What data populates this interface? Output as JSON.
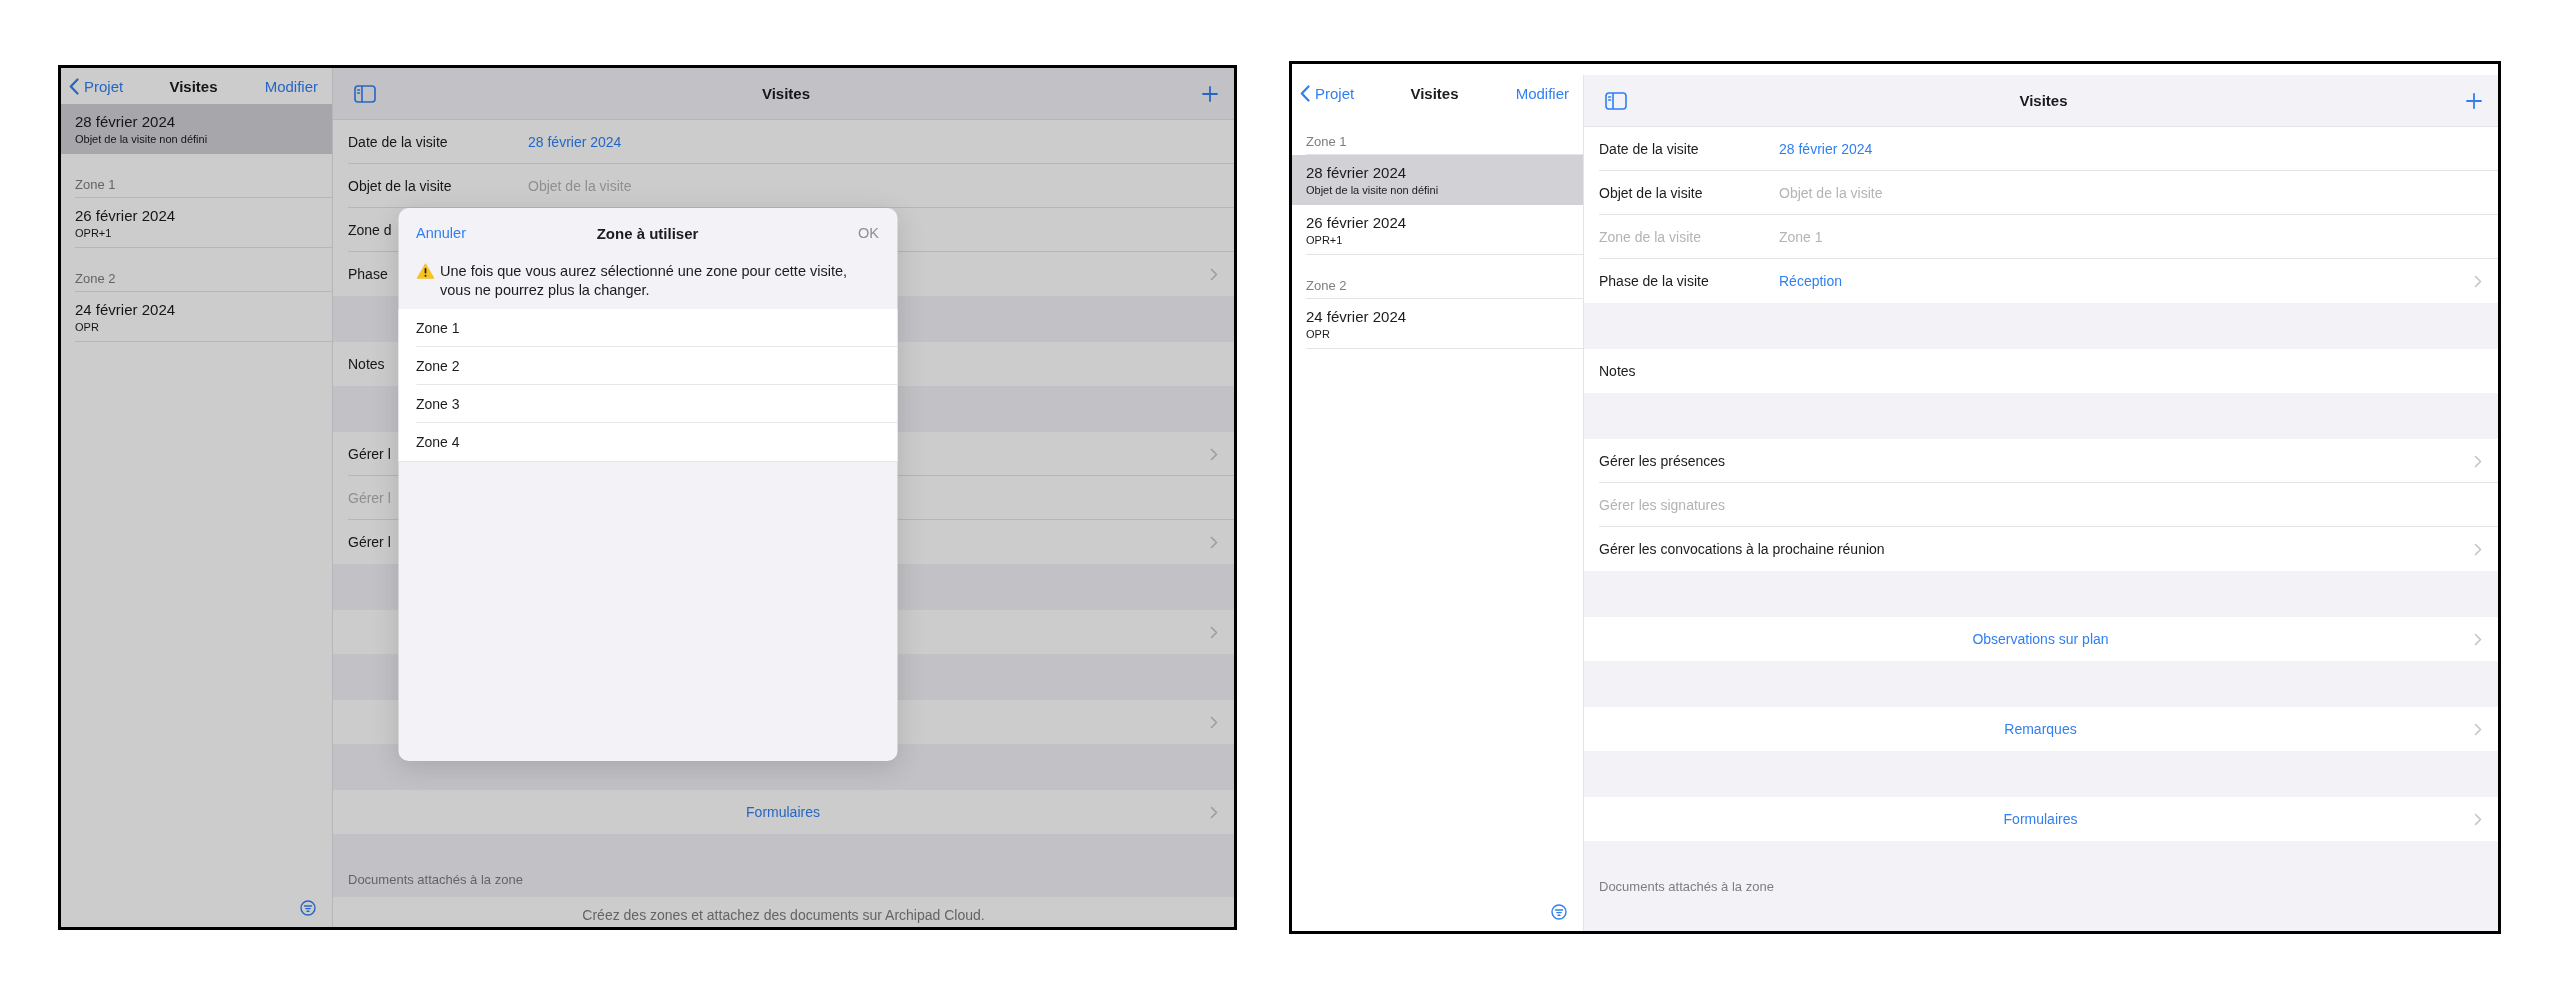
{
  "screens": [
    {
      "dimmed": true,
      "sidebar": {
        "back": "Projet",
        "title": "Visites",
        "edit": "Modifier",
        "sections": [
          {
            "items": [
              {
                "date": "28 février 2024",
                "subtitle": "Objet de la visite non défini",
                "selected": true
              }
            ]
          },
          {
            "title": "Zone 1",
            "items": [
              {
                "date": "26 février 2024",
                "subtitle": "OPR+1",
                "selected": false
              }
            ]
          },
          {
            "title": "Zone 2",
            "items": [
              {
                "date": "24 février 2024",
                "subtitle": "OPR",
                "selected": false
              }
            ]
          }
        ]
      },
      "detail": {
        "title": "Visites",
        "groups": [
          {
            "rows": [
              {
                "kind": "field",
                "label": "Date de la visite",
                "value": "28 février 2024",
                "disabled": false,
                "chevron": false
              },
              {
                "kind": "field",
                "label": "Objet de la visite",
                "placeholder": "Objet de la visite",
                "disabled": false,
                "chevron": false
              },
              {
                "kind": "field",
                "label": "Zone d",
                "disabled": false,
                "chevron": false
              },
              {
                "kind": "field",
                "label": "Phase",
                "disabled": false,
                "chevron": true
              }
            ]
          },
          {
            "rows": [
              {
                "kind": "field",
                "label": "Notes",
                "disabled": false,
                "chevron": false
              }
            ]
          },
          {
            "rows": [
              {
                "kind": "field",
                "label": "Gérer l",
                "disabled": false,
                "chevron": true
              },
              {
                "kind": "field",
                "label": "Gérer l",
                "disabled": true,
                "chevron": false
              },
              {
                "kind": "field",
                "label": "Gérer l",
                "disabled": false,
                "chevron": true
              }
            ]
          },
          {
            "rows": [
              {
                "kind": "action",
                "disabled": false,
                "chevron": true
              }
            ]
          },
          {
            "rows": [
              {
                "kind": "action",
                "disabled": false,
                "chevron": true
              }
            ]
          },
          {
            "rows": [
              {
                "kind": "action",
                "label": "Formulaires",
                "disabled": false,
                "chevron": true
              }
            ]
          }
        ],
        "footer": {
          "caption": "Documents attachés à la zone",
          "info": "Créez des zones et attachez des documents sur Archipad Cloud."
        }
      },
      "modal": {
        "cancel": "Annuler",
        "title": "Zone à utiliser",
        "confirm": {
          "label": "OK",
          "disabled": true
        },
        "warning": "Une fois que vous aurez sélectionné une zone pour cette visite, vous ne pourrez plus la changer.",
        "options": [
          {
            "label": "Zone 1",
            "selected": false
          },
          {
            "label": "Zone 2",
            "selected": false
          },
          {
            "label": "Zone 3",
            "selected": false
          },
          {
            "label": "Zone 4",
            "selected": false
          }
        ]
      }
    },
    {
      "dimmed": false,
      "sidebar": {
        "back": "Projet",
        "title": "Visites",
        "edit": "Modifier",
        "sections": [
          {
            "title": "Zone 1",
            "items": [
              {
                "date": "28 février 2024",
                "subtitle": "Objet de la visite non défini",
                "selected": true
              },
              {
                "date": "26 février 2024",
                "subtitle": "OPR+1",
                "selected": false
              }
            ]
          },
          {
            "title": "Zone 2",
            "items": [
              {
                "date": "24 février 2024",
                "subtitle": "OPR",
                "selected": false
              }
            ]
          }
        ]
      },
      "detail": {
        "title": "Visites",
        "groups": [
          {
            "rows": [
              {
                "kind": "field",
                "label": "Date de la visite",
                "value": "28 février 2024",
                "disabled": false,
                "chevron": false
              },
              {
                "kind": "field",
                "label": "Objet de la visite",
                "placeholder": "Objet de la visite",
                "disabled": false,
                "chevron": false
              },
              {
                "kind": "field",
                "label": "Zone de la visite",
                "value": "Zone 1",
                "disabled": true,
                "chevron": false
              },
              {
                "kind": "field",
                "label": "Phase de la visite",
                "value": "Réception",
                "disabled": false,
                "chevron": true
              }
            ]
          },
          {
            "rows": [
              {
                "kind": "field",
                "label": "Notes",
                "disabled": false,
                "chevron": false
              }
            ]
          },
          {
            "rows": [
              {
                "kind": "field",
                "label": "Gérer les présences",
                "disabled": false,
                "chevron": true
              },
              {
                "kind": "field",
                "label": "Gérer les signatures",
                "disabled": true,
                "chevron": false
              },
              {
                "kind": "field",
                "label": "Gérer les convocations à la prochaine réunion",
                "disabled": false,
                "chevron": true
              }
            ]
          },
          {
            "rows": [
              {
                "kind": "action",
                "label": "Observations sur plan",
                "disabled": false,
                "chevron": true
              }
            ]
          },
          {
            "rows": [
              {
                "kind": "action",
                "label": "Remarques",
                "disabled": false,
                "chevron": true
              }
            ]
          },
          {
            "rows": [
              {
                "kind": "action",
                "label": "Formulaires",
                "disabled": false,
                "chevron": true
              }
            ]
          }
        ],
        "footer": {
          "caption": "Documents attachés à la zone"
        }
      }
    }
  ]
}
